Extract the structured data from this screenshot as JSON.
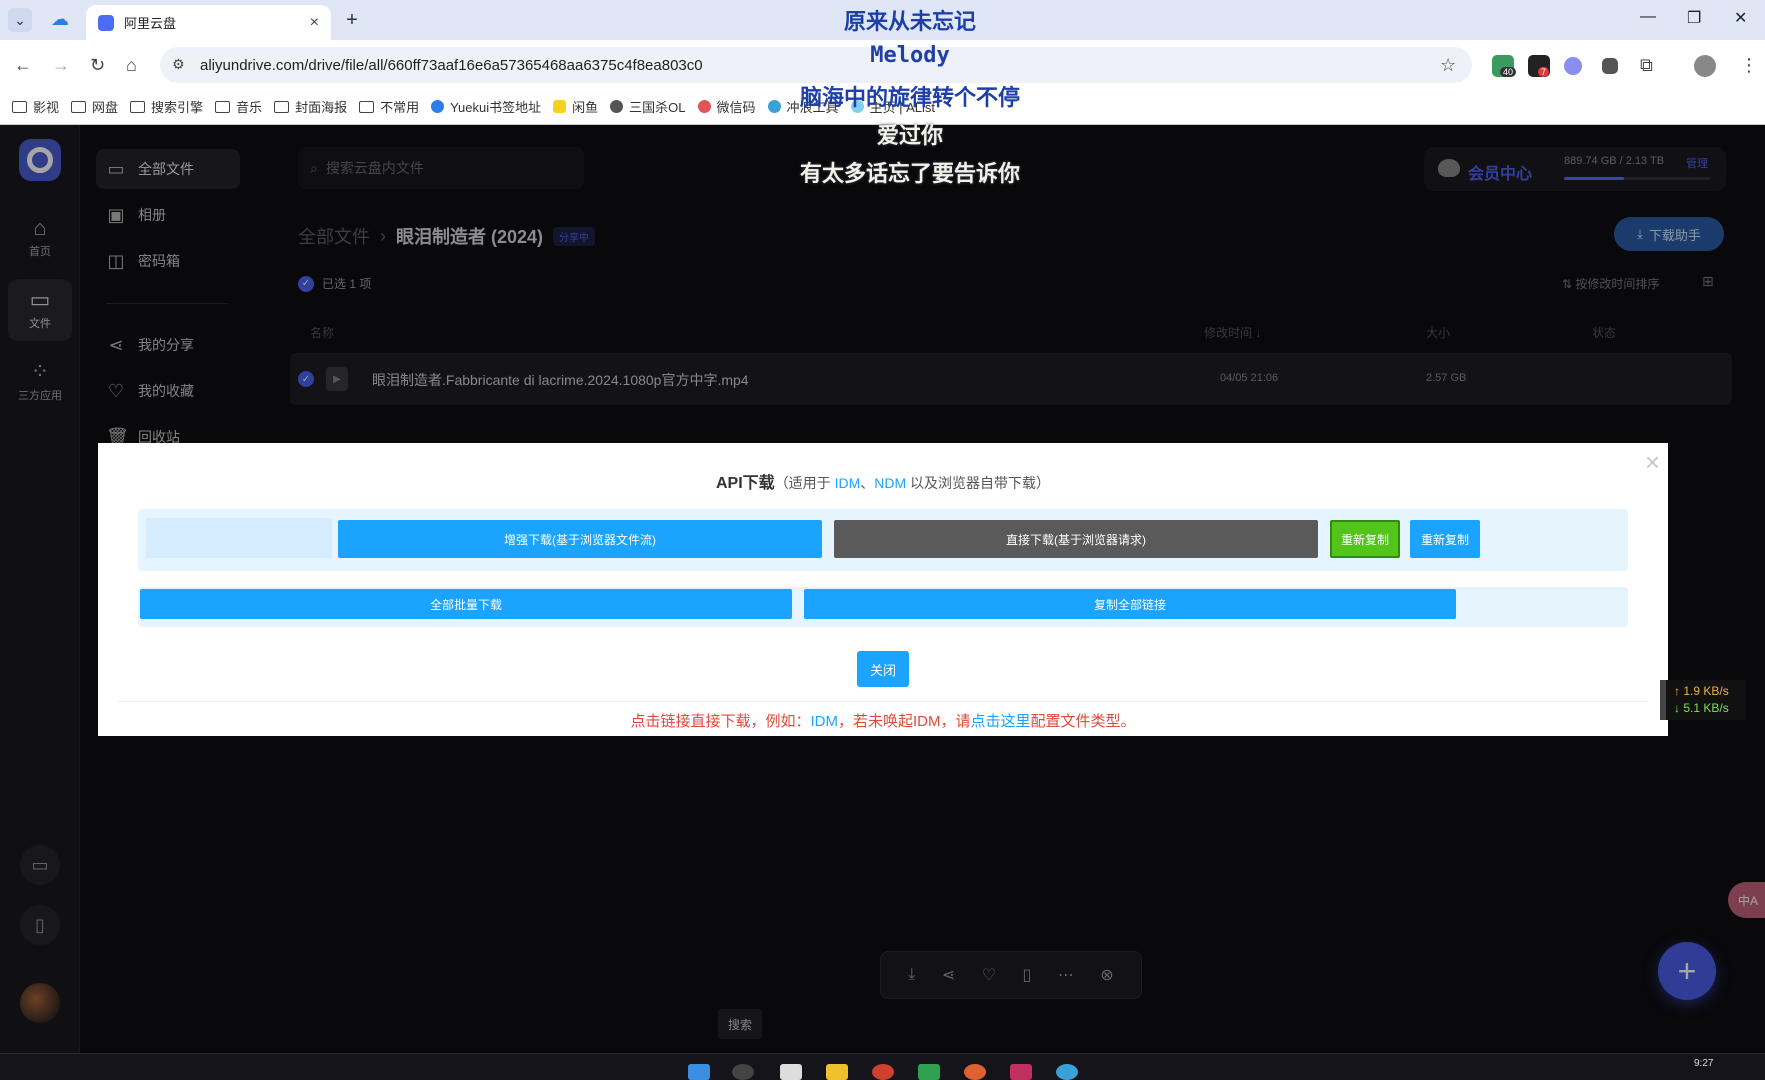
{
  "browser": {
    "tab_title": "阿里云盘",
    "tab_close": "×",
    "new_tab": "+",
    "url": "aliyundrive.com/drive/file/all/660ff73aaf16e6a57365468aa6375c4f8ea803c0",
    "ext_badge_1": "40",
    "ext_badge_2": "7",
    "bookmarks": [
      "影视",
      "网盘",
      "搜索引擎",
      "音乐",
      "封面海报",
      "不常用",
      "Yuekui书签地址",
      "闲鱼",
      "三国杀OL",
      "微信码",
      "冲浪工具",
      "主页 | AList"
    ]
  },
  "lyrics": {
    "line1": "原来从未忘记",
    "line2": "Melody",
    "line3": "脑海中的旋律转个不停",
    "line4": "爱过你",
    "line5": "有太多话忘了要告诉你"
  },
  "rail": {
    "home_label": "首页",
    "files_label": "文件",
    "apps_label": "三方应用"
  },
  "sidebar": {
    "items": [
      {
        "label": "全部文件"
      },
      {
        "label": "相册"
      },
      {
        "label": "密码箱"
      },
      {
        "label": "我的分享"
      },
      {
        "label": "我的收藏"
      },
      {
        "label": "回收站"
      }
    ]
  },
  "header": {
    "search_placeholder": "搜索云盘内文件",
    "vip_label": "会员中心",
    "storage": "889.74 GB / 2.13 TB",
    "storage_used_fraction": 0.41,
    "manage": "管理",
    "download_helper": "下载助手"
  },
  "breadcrumb": {
    "root": "全部文件",
    "sep": "›",
    "current": "眼泪制造者 (2024)",
    "badge": "分享中"
  },
  "list": {
    "selected": "已选 1 项",
    "sort": "按修改时间排序",
    "col_name": "名称",
    "col_modified": "修改时间 ↓",
    "col_size": "大小",
    "col_status": "状态",
    "file": {
      "name": "眼泪制造者.Fabbricante di lacrime.2024.1080p官方中字.mp4",
      "modified": "04/05 21:06",
      "size": "2.57 GB"
    }
  },
  "dialog": {
    "title": "API下载",
    "subtitle_pre": "（适用于 ",
    "idm": "IDM",
    "comma": "、",
    "ndm": "NDM",
    "subtitle_post": " 以及浏览器自带下载）",
    "link_placeholder": "",
    "btn_enhanced": "增强下载(基于浏览器文件流)",
    "btn_direct": "直接下载(基于浏览器请求)",
    "btn_recopy_green": "重新复制",
    "btn_recopy_blue": "重新复制",
    "btn_download_all": "全部批量下载",
    "btn_copy_all": "复制全部链接",
    "btn_close": "关闭",
    "note_pre": "点击链接直接下载，例如：",
    "note_idm": "IDM",
    "note_mid": "，若未唤起IDM，请",
    "note_link": "点击这里",
    "note_post": "配置文件类型。",
    "close_x": "×"
  },
  "speed": {
    "up": "↑ 1.9 KB/s",
    "down": "↓ 5.1 KB/s"
  },
  "tooltip": "搜索",
  "translate": "中A",
  "clock": "9:27",
  "colors": {
    "accent": "#1aa3ff",
    "app_accent": "#4a63f0",
    "recopy_green": "#52c41a",
    "direct_grey": "#5a5a5a",
    "note_red": "#e04a3a"
  }
}
